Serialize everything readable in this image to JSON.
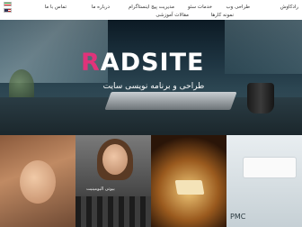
{
  "nav": {
    "items": [
      "رادکاوش",
      "طراحی وب",
      "خدمات سئو",
      "مدیریت پیج اینستاگرام",
      "نمونه کارها",
      "مقالات آموزشی",
      "درباره ما",
      "تماس با ما"
    ]
  },
  "hero": {
    "logo_highlight": "R",
    "logo_rest": "ADSITE",
    "tagline": "طراحی و برنامه نویسی سایت"
  },
  "tiles": {
    "chess_caption": "بیوتی الیومینیت",
    "tile4_text": "PMC"
  },
  "colors": {
    "brand_pink": "#e0337a"
  }
}
